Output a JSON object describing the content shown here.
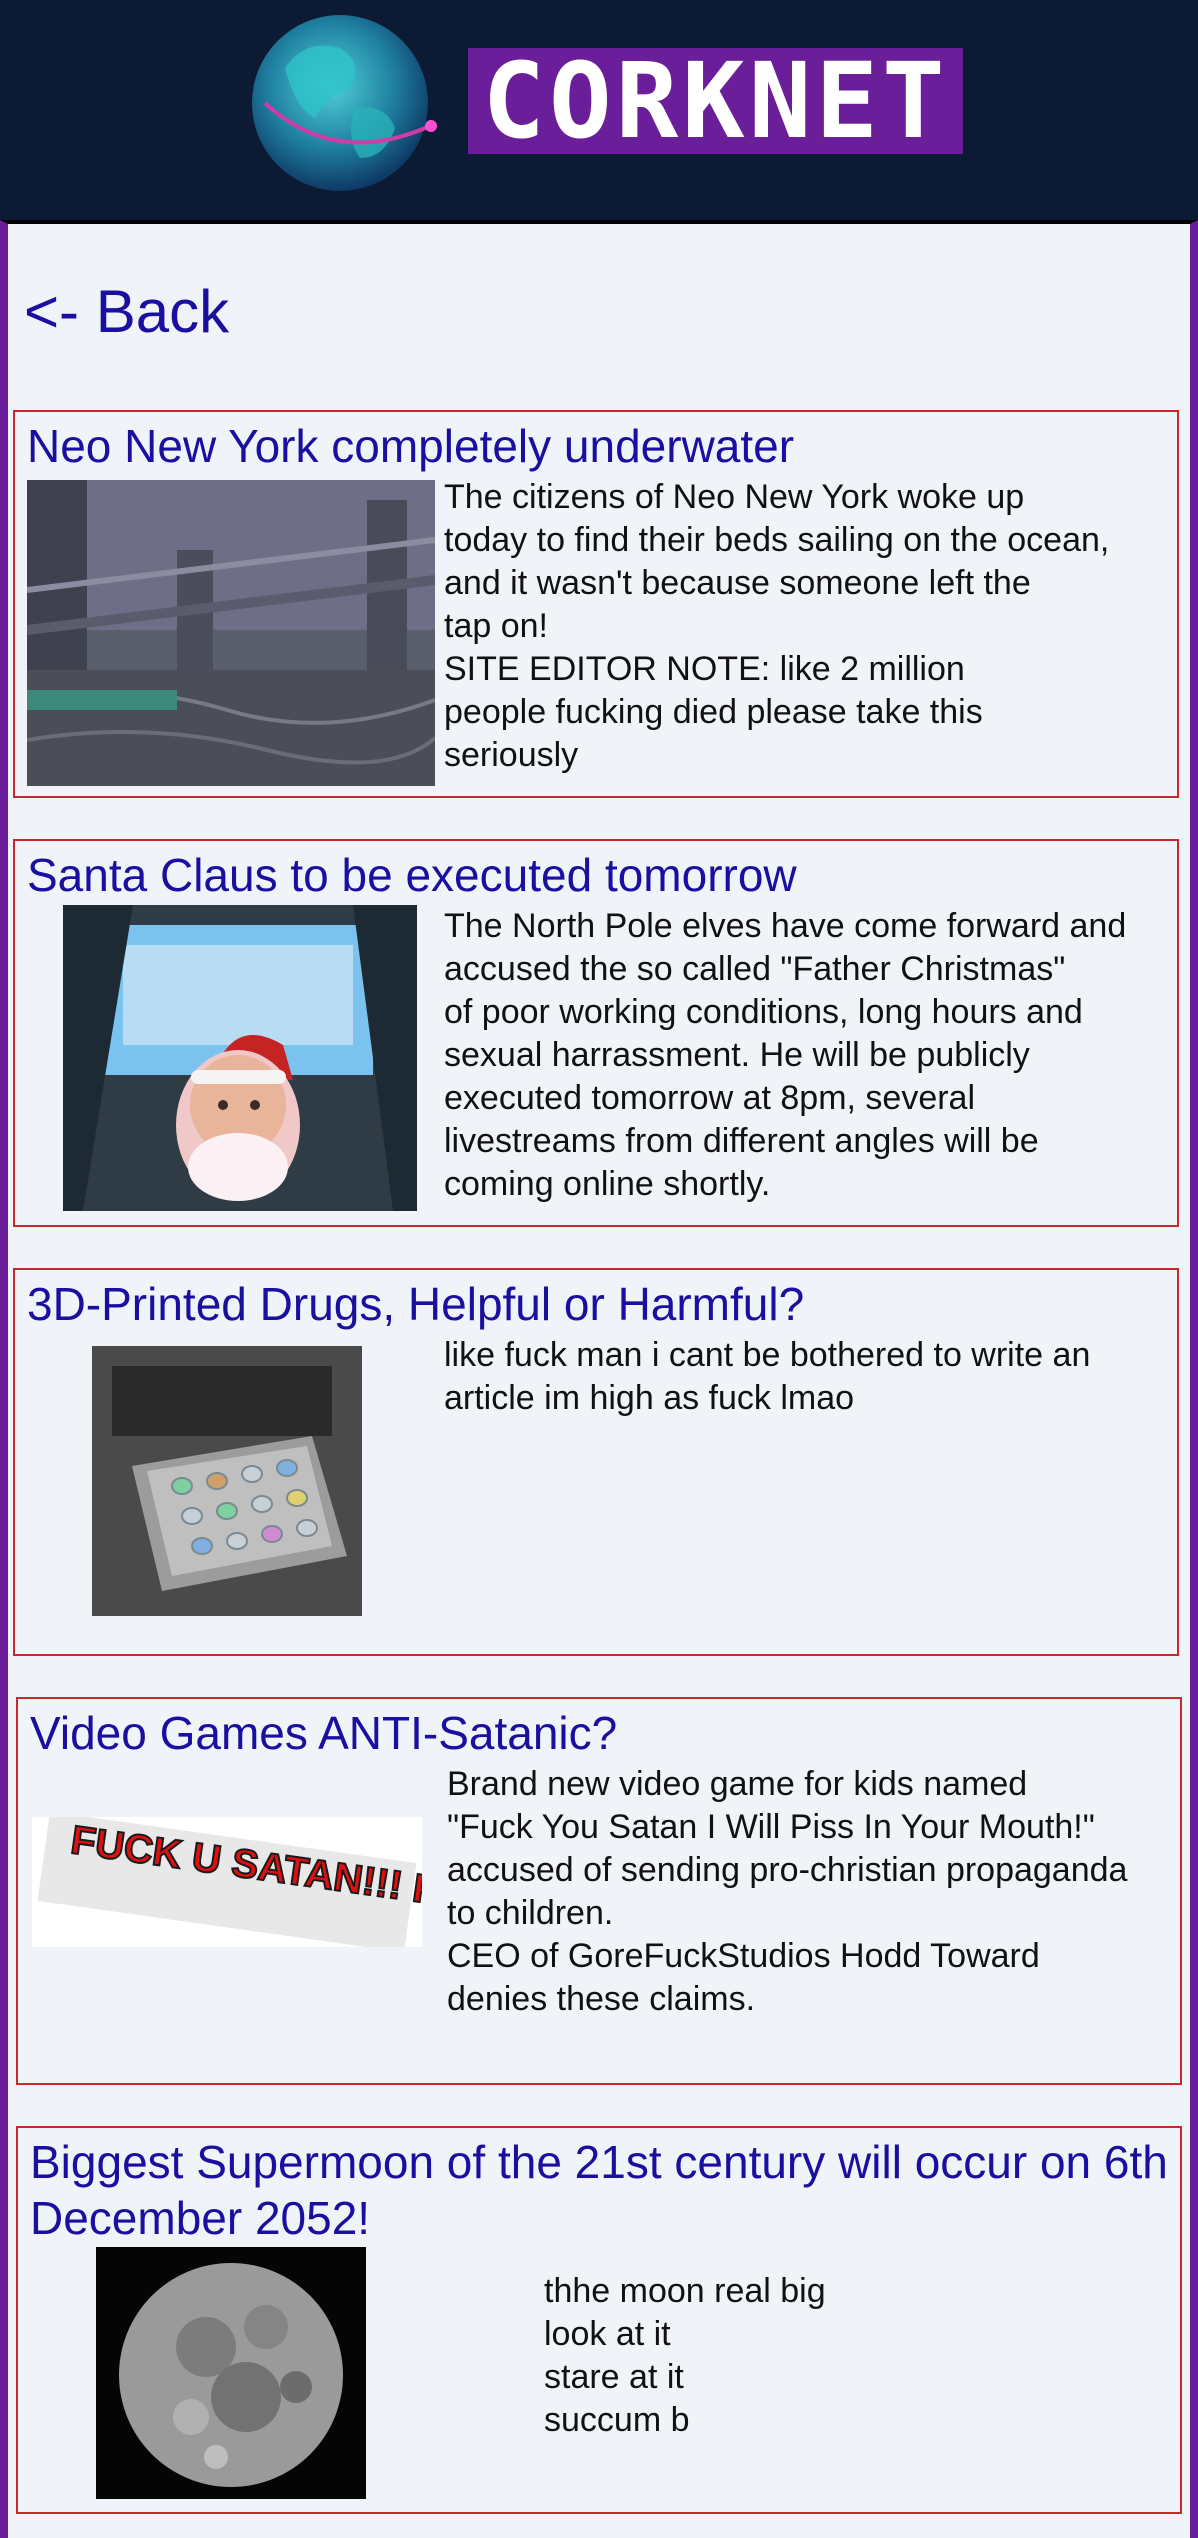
{
  "header": {
    "logo_text": "corknet"
  },
  "nav": {
    "back_label": "<- Back"
  },
  "articles": [
    {
      "title": "Neo New York completely underwater",
      "image": "flooded-city-bridge",
      "body": [
        "The citizens of Neo New York woke up",
        "today to find their beds sailing on the ocean,",
        "and it wasn't because someone left the",
        "tap on!",
        "SITE EDITOR NOTE: like 2 million",
        "people fucking died please take this",
        "seriously"
      ]
    },
    {
      "title": "Santa Claus to be executed tomorrow",
      "image": "santa-claus-portrait",
      "body": [
        "The North Pole elves have come forward and",
        "accused the so called \"Father Christmas\"",
        "of poor working conditions, long hours and",
        "sexual harrassment. He will be publicly",
        "executed tomorrow at 8pm, several",
        "livestreams from different angles will be",
        "coming online shortly."
      ]
    },
    {
      "title": "3D-Printed Drugs, Helpful or Harmful?",
      "image": "3d-printer-pills",
      "body": [
        "like fuck man i cant be bothered to write an",
        "article im high as fuck lmao"
      ]
    },
    {
      "title": "Video Games ANTI-Satanic?",
      "image": "game-title-graphic",
      "image_text": "FUCK U SATAN!!! FUCK RIGHT OFF!!!",
      "body": [
        "Brand new video game for kids named",
        "\"Fuck You Satan I Will Piss In Your Mouth!\"",
        "accused of sending pro-christian propaganda",
        "to children.",
        "CEO of GoreFuckStudios Hodd Toward",
        "denies these claims."
      ]
    },
    {
      "title": "Biggest Supermoon of the 21st century will occur on 6th December 2052!",
      "image": "full-moon",
      "body": [
        "thhe moon real big",
        "look at it",
        "stare at it",
        "succum b"
      ]
    }
  ]
}
